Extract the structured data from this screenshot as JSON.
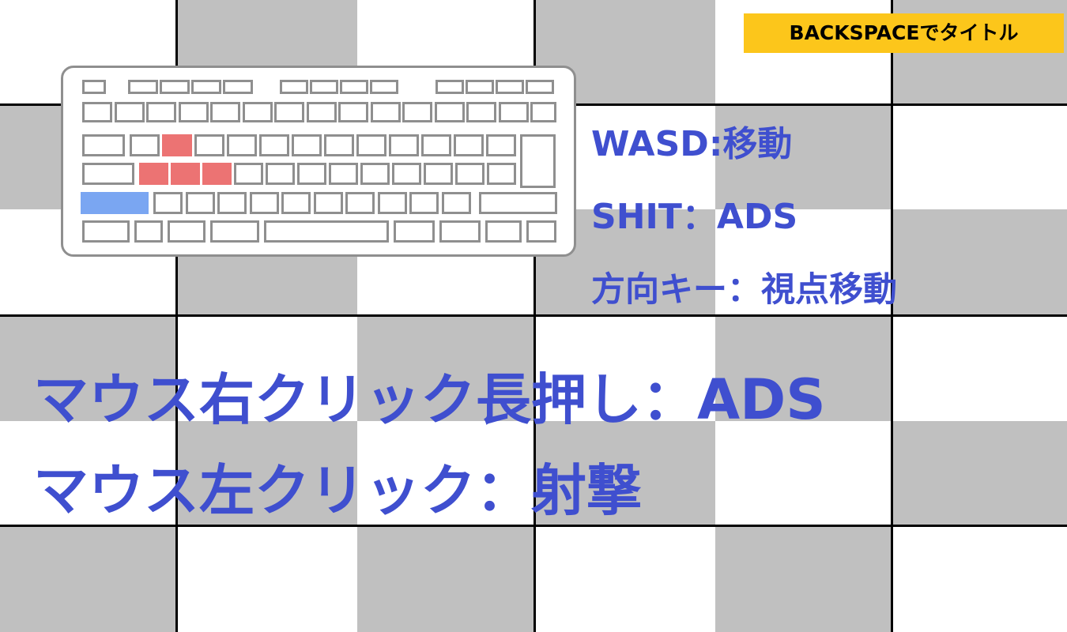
{
  "title_hint": "BACKSPACEでタイトル",
  "controls": {
    "move": "WASD:移動",
    "shift": "SHIT：ADS",
    "look": "方向キー：視点移動",
    "right_click": "マウス右クリック長押し：ADS",
    "left_click": "マウス左クリック：射撃"
  },
  "colors": {
    "text_blue": "#3f4fcf",
    "badge_yellow": "#fcc61b",
    "checker_gray": "#c0c0c0",
    "highlight_red": "#ec7373",
    "highlight_blue": "#7aa6f2"
  },
  "keyboard": {
    "highlighted_keys": [
      "W",
      "A",
      "S",
      "D",
      "Left Shift"
    ]
  }
}
